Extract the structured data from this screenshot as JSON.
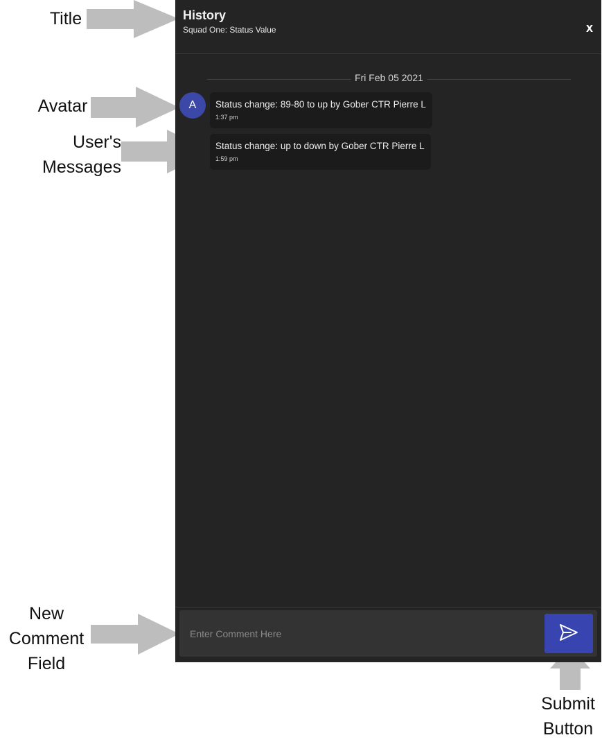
{
  "annotations": {
    "title": "Title",
    "avatar": "Avatar",
    "messages": "User's\nMessages",
    "comment_field": "New\nComment\nField",
    "submit": "Submit\nButton"
  },
  "panel": {
    "title": "History",
    "subtitle": "Squad One: Status Value",
    "close_label": "x",
    "date": "Fri Feb 05 2021",
    "avatar_initial": "A",
    "messages": [
      {
        "text": "Status change: 89-80 to up by Gober CTR Pierre L",
        "time": "1:37 pm"
      },
      {
        "text": "Status change: up to down by Gober CTR Pierre L",
        "time": "1:59 pm"
      }
    ],
    "comment_placeholder": "Enter Comment Here",
    "send_icon": "send-icon"
  },
  "colors": {
    "panel_bg": "#242424",
    "message_bg": "#1b1b1b",
    "accent": "#3844b0",
    "avatar_bg": "#3b48a8",
    "annotation_arrow": "#bdbdbd"
  }
}
